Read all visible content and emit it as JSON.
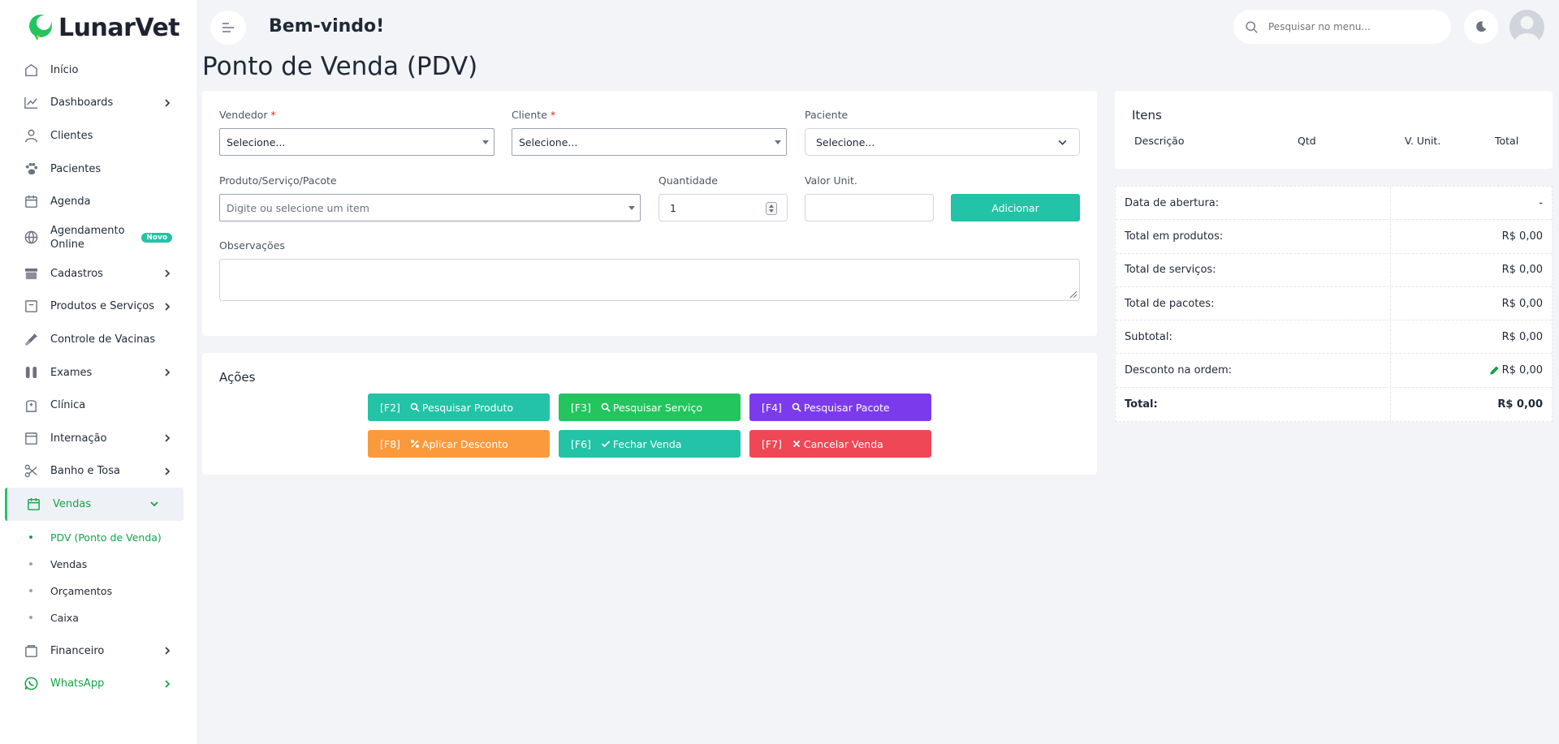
{
  "app": {
    "logo_text": "LunarVet"
  },
  "colors": {
    "accent_green": "#16a34a",
    "teal": "#22c3a6",
    "green": "#22c55e",
    "purple": "#7c3aed",
    "orange": "#fb9a3c",
    "red": "#ef4755"
  },
  "sidebar": {
    "items": [
      {
        "label": "Início",
        "icon": "home-icon",
        "chevron": false
      },
      {
        "label": "Dashboards",
        "icon": "chart-line-icon",
        "chevron": true
      },
      {
        "label": "Clientes",
        "icon": "user-icon",
        "chevron": false
      },
      {
        "label": "Pacientes",
        "icon": "paw-icon",
        "chevron": false
      },
      {
        "label": "Agenda",
        "icon": "calendar-icon",
        "chevron": false
      },
      {
        "label": "Agendamento Online",
        "icon": "globe-icon",
        "badge": "Novo"
      },
      {
        "label": "Cadastros",
        "icon": "archive-icon",
        "chevron": true
      },
      {
        "label": "Produtos e Serviços",
        "icon": "box-icon",
        "chevron": true
      },
      {
        "label": "Controle de Vacinas",
        "icon": "syringe-icon",
        "chevron": false
      },
      {
        "label": "Exames",
        "icon": "test-tubes-icon",
        "chevron": true
      },
      {
        "label": "Clínica",
        "icon": "building-icon",
        "chevron": false
      },
      {
        "label": "Internação",
        "icon": "bed-icon",
        "chevron": true
      },
      {
        "label": "Banho e Tosa",
        "icon": "scissors-icon",
        "chevron": true
      },
      {
        "label": "Vendas",
        "icon": "store-icon",
        "chevron": true,
        "active": true
      }
    ],
    "sub_items": [
      {
        "label": "PDV (Ponto de Venda)",
        "active": true
      },
      {
        "label": "Vendas"
      },
      {
        "label": "Orçamentos"
      },
      {
        "label": "Caixa"
      }
    ],
    "after_items": [
      {
        "label": "Financeiro",
        "icon": "wallet-icon",
        "chevron": true
      },
      {
        "label": "WhatsApp",
        "icon": "whatsapp-icon",
        "chevron": true
      }
    ]
  },
  "header": {
    "welcome": "Bem-vindo!",
    "search_placeholder": "Pesquisar no menu..."
  },
  "page": {
    "title": "Ponto de Venda (PDV)"
  },
  "form": {
    "vendedor_label": "Vendedor",
    "vendedor_value": "Selecione...",
    "cliente_label": "Cliente",
    "cliente_value": "Selecione...",
    "paciente_label": "Paciente",
    "paciente_value": "Selecione...",
    "produto_label": "Produto/Serviço/Pacote",
    "produto_placeholder": "Digite ou selecione um item",
    "quantidade_label": "Quantidade",
    "quantidade_value": "1",
    "valor_label": "Valor Unit.",
    "valor_value": "",
    "add_button": "Adicionar",
    "obs_label": "Observações",
    "required_mark": "*"
  },
  "actions": {
    "title": "Ações",
    "buttons": [
      {
        "key": "[F2]",
        "label": "Pesquisar Produto",
        "icon": "search-icon",
        "color": "#22c3a6"
      },
      {
        "key": "[F3]",
        "label": "Pesquisar Serviço",
        "icon": "search-icon",
        "color": "#22c55e"
      },
      {
        "key": "[F4]",
        "label": "Pesquisar Pacote",
        "icon": "search-icon",
        "color": "#7c3aed"
      },
      {
        "key": "[F8]",
        "label": "Aplicar Desconto",
        "icon": "percent-icon",
        "color": "#fb9a3c"
      },
      {
        "key": "[F6]",
        "label": "Fechar Venda",
        "icon": "check-icon",
        "color": "#22c3a6"
      },
      {
        "key": "[F7]",
        "label": "Cancelar Venda",
        "icon": "x-icon",
        "color": "#ef4755"
      }
    ]
  },
  "items_panel": {
    "title": "Itens",
    "columns": [
      "Descrição",
      "Qtd",
      "V. Unit.",
      "Total"
    ]
  },
  "summary": {
    "rows": [
      {
        "label": "Data de abertura:",
        "value": "-"
      },
      {
        "label": "Total em produtos:",
        "value": "R$ 0,00"
      },
      {
        "label": "Total de serviços:",
        "value": "R$ 0,00"
      },
      {
        "label": "Total de pacotes:",
        "value": "R$ 0,00"
      },
      {
        "label": "Subtotal:",
        "value": "R$ 0,00"
      },
      {
        "label": "Desconto na ordem:",
        "value": "R$ 0,00"
      },
      {
        "label": "Total:",
        "value": "R$ 0,00"
      }
    ]
  }
}
